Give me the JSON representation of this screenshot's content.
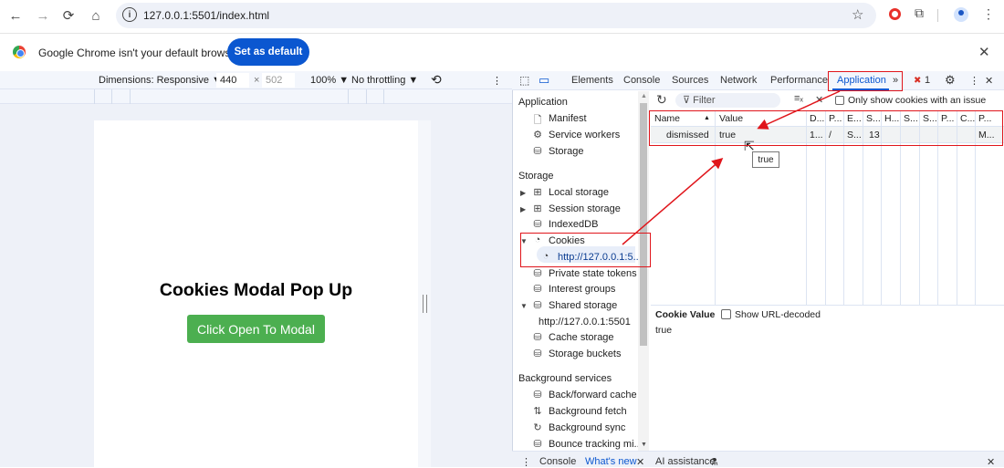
{
  "browser": {
    "url": "127.0.0.1:5501/index.html",
    "nav": {
      "back": "←",
      "forward": "→",
      "reload": "⟳",
      "home": "⌂"
    },
    "icons": {
      "star": "☆",
      "extensions": "⧉",
      "menu": "⋮",
      "info": "i"
    }
  },
  "infobar": {
    "message": "Google Chrome isn't your default browser",
    "button": "Set as default",
    "close": "✕"
  },
  "device_toolbar": {
    "dimensions": "Dimensions: Responsive ▼",
    "width": "440",
    "times": "×",
    "height": "502",
    "zoom": "100% ▼",
    "throttling": "No throttling ▼",
    "rotate": "⟲",
    "menu": "⋮"
  },
  "page": {
    "heading": "Cookies Modal Pop Up",
    "button": "Click Open To Modal",
    "button_color": "#4caf50"
  },
  "devtools": {
    "tabs": [
      "Elements",
      "Console",
      "Sources",
      "Network",
      "Performance",
      "Application"
    ],
    "active_tab": "Application",
    "more_tabs": "»",
    "error_count": "1",
    "icons": {
      "inspect": "⬚",
      "device": "▭",
      "settings": "⚙",
      "menu": "⋮",
      "close": "✕",
      "error": "✖"
    },
    "sidebar": {
      "application_section": "Application",
      "application_items": [
        "Manifest",
        "Service workers",
        "Storage"
      ],
      "storage_section": "Storage",
      "storage_items": {
        "local_storage": "Local storage",
        "session_storage": "Session storage",
        "indexeddb": "IndexedDB",
        "cookies": "Cookies",
        "cookie_origin": "http://127.0.0.1:5...",
        "private_state_tokens": "Private state tokens",
        "interest_groups": "Interest groups",
        "shared_storage": "Shared storage",
        "shared_storage_origin": "http://127.0.0.1:5501",
        "cache_storage": "Cache storage",
        "storage_buckets": "Storage buckets"
      },
      "background_section": "Background services",
      "background_items": [
        "Back/forward cache",
        "Background fetch",
        "Background sync",
        "Bounce tracking mi..."
      ]
    },
    "cookies": {
      "filter_placeholder": "Filter",
      "only_issues_label": "Only show cookies with an issue",
      "columns": [
        "Name",
        "Value",
        "D...",
        "P...",
        "E...",
        "S...",
        "H...",
        "S...",
        "S...",
        "P...",
        "C...",
        "P..."
      ],
      "rows": [
        [
          "dismissed",
          "true",
          "1...",
          "/",
          "S...",
          "13",
          "",
          "",
          "",
          "",
          "",
          "M..."
        ]
      ],
      "tooltip": "true",
      "cookie_value_label": "Cookie Value",
      "show_url_decoded": "Show URL-decoded",
      "cookie_value": "true"
    },
    "drawer": {
      "menu": "⋮",
      "tabs": [
        "Console",
        "What's new",
        "AI assistance"
      ],
      "active_tab": "What's new",
      "close": "✕"
    }
  }
}
